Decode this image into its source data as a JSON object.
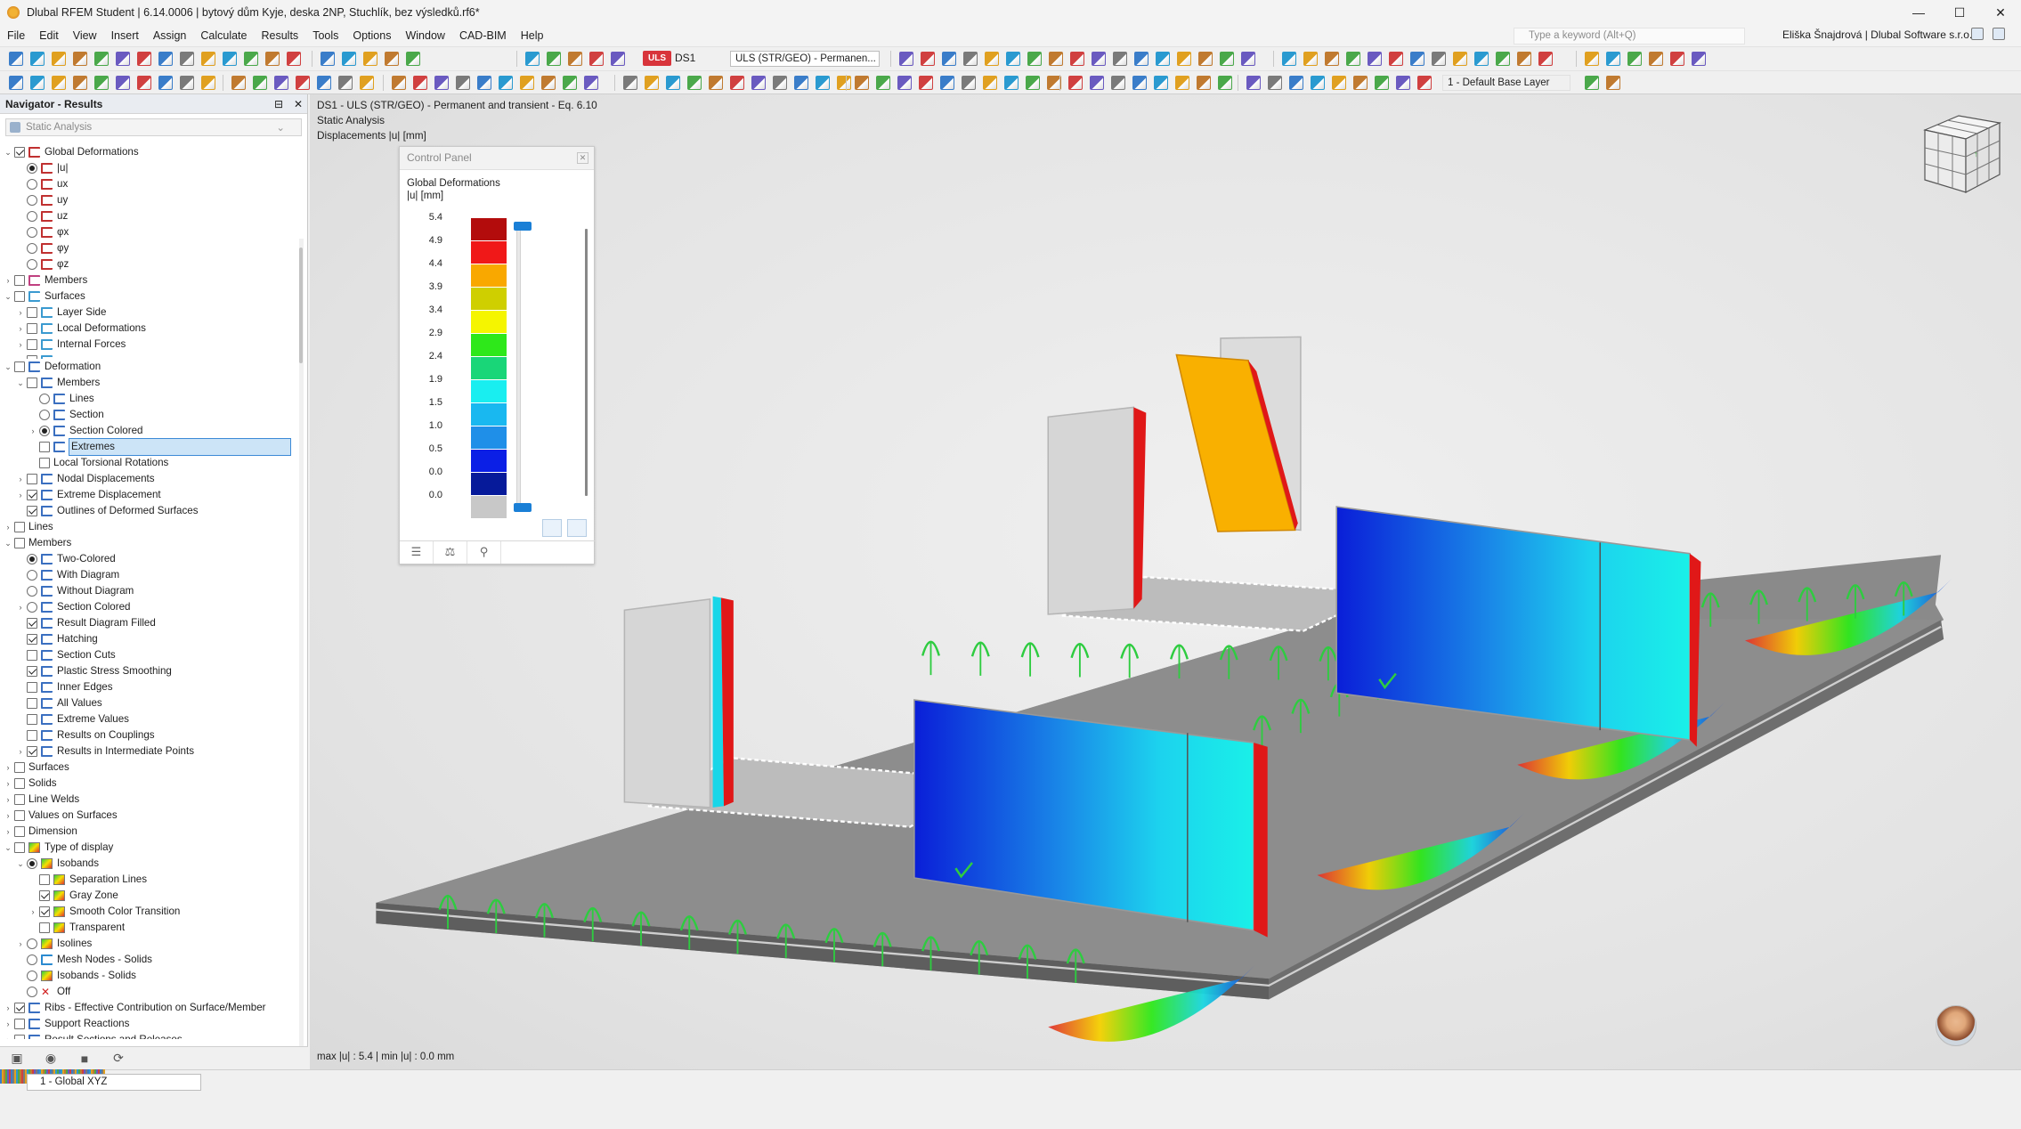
{
  "window": {
    "title": "Dlubal RFEM Student | 6.14.0006 | bytový dům Kyje, deska 2NP, Stuchlík, bez výsledků.rf6*",
    "minimize": "—",
    "maximize": "☐",
    "close": "✕"
  },
  "menu": {
    "items": [
      "File",
      "Edit",
      "View",
      "Insert",
      "Assign",
      "Calculate",
      "Results",
      "Tools",
      "Options",
      "Window",
      "CAD-BIM",
      "Help"
    ],
    "search_placeholder": "Type a keyword (Alt+Q)",
    "user": "Eliška Šnajdrová | Dlubal Software s.r.o."
  },
  "toolbar": {
    "uls_badge": "ULS",
    "design_situation": "DS1",
    "combination": "ULS (STR/GEO) - Permanen...",
    "layer": "1 - Default Base Layer"
  },
  "navigator": {
    "title": "Navigator - Results",
    "analysis_type": "Static Analysis",
    "tree": [
      {
        "label": "Global Deformations",
        "depth": 0,
        "expander": "open",
        "check": "on",
        "icon": "deform"
      },
      {
        "label": "|u|",
        "depth": 1,
        "radio": "on",
        "icon": "deform"
      },
      {
        "label": "ux",
        "depth": 1,
        "radio": "off",
        "icon": "deform"
      },
      {
        "label": "uy",
        "depth": 1,
        "radio": "off",
        "icon": "deform"
      },
      {
        "label": "uz",
        "depth": 1,
        "radio": "off",
        "icon": "deform"
      },
      {
        "label": "φx",
        "depth": 1,
        "radio": "off",
        "icon": "deform"
      },
      {
        "label": "φy",
        "depth": 1,
        "radio": "off",
        "icon": "deform"
      },
      {
        "label": "φz",
        "depth": 1,
        "radio": "off",
        "icon": "deform"
      },
      {
        "label": "Members",
        "depth": 0,
        "expander": "closed",
        "check": "off",
        "icon": "member"
      },
      {
        "label": "Surfaces",
        "depth": 0,
        "expander": "open",
        "check": "off",
        "icon": "surface"
      },
      {
        "label": "Layer Side",
        "depth": 1,
        "expander": "closed",
        "check": "off",
        "icon": "surface"
      },
      {
        "label": "Local Deformations",
        "depth": 1,
        "expander": "closed",
        "check": "off",
        "icon": "surface"
      },
      {
        "label": "Internal Forces",
        "depth": 1,
        "expander": "closed",
        "check": "off",
        "icon": "surface"
      },
      {
        "label": "",
        "depth": 1,
        "expander": "closed",
        "check": "off",
        "icon": "surface",
        "clipped": true
      },
      {
        "label": "Deformation",
        "depth": 0,
        "expander": "open",
        "check": "off",
        "icon": "deform2"
      },
      {
        "label": "Members",
        "depth": 1,
        "expander": "open",
        "check": "off",
        "icon": "deform2"
      },
      {
        "label": "Lines",
        "depth": 2,
        "radio": "off",
        "icon": "deform2"
      },
      {
        "label": "Section",
        "depth": 2,
        "radio": "off",
        "icon": "deform2"
      },
      {
        "label": "Section Colored",
        "depth": 2,
        "expander": "closed",
        "radio": "on",
        "icon": "deform2"
      },
      {
        "label": "Extremes",
        "depth": 2,
        "check": "off",
        "icon": "deform2",
        "selected": true
      },
      {
        "label": "Local Torsional Rotations",
        "depth": 2,
        "check": "off",
        "icon": "none"
      },
      {
        "label": "Nodal Displacements",
        "depth": 1,
        "expander": "closed",
        "check": "off",
        "icon": "deform2"
      },
      {
        "label": "Extreme Displacement",
        "depth": 1,
        "expander": "closed",
        "check": "on",
        "icon": "deform2"
      },
      {
        "label": "Outlines of Deformed Surfaces",
        "depth": 1,
        "check": "on",
        "icon": "deform2"
      },
      {
        "label": "Lines",
        "depth": 0,
        "expander": "closed",
        "check": "off",
        "icon": "none"
      },
      {
        "label": "Members",
        "depth": 0,
        "expander": "open",
        "check": "off",
        "icon": "none"
      },
      {
        "label": "Two-Colored",
        "depth": 1,
        "radio": "on",
        "icon": "deform2"
      },
      {
        "label": "With Diagram",
        "depth": 1,
        "radio": "off",
        "icon": "deform2"
      },
      {
        "label": "Without Diagram",
        "depth": 1,
        "radio": "off",
        "icon": "deform2"
      },
      {
        "label": "Section Colored",
        "depth": 1,
        "expander": "closed",
        "radio": "off",
        "icon": "deform2"
      },
      {
        "label": "Result Diagram Filled",
        "depth": 1,
        "check": "on",
        "icon": "deform2"
      },
      {
        "label": "Hatching",
        "depth": 1,
        "check": "on",
        "icon": "deform2"
      },
      {
        "label": "Section Cuts",
        "depth": 1,
        "check": "off",
        "icon": "deform2"
      },
      {
        "label": "Plastic Stress Smoothing",
        "depth": 1,
        "check": "on",
        "icon": "deform2"
      },
      {
        "label": "Inner Edges",
        "depth": 1,
        "check": "off",
        "icon": "deform2"
      },
      {
        "label": "All Values",
        "depth": 1,
        "check": "off",
        "icon": "deform2"
      },
      {
        "label": "Extreme Values",
        "depth": 1,
        "check": "off",
        "icon": "deform2"
      },
      {
        "label": "Results on Couplings",
        "depth": 1,
        "check": "off",
        "icon": "deform2"
      },
      {
        "label": "Results in Intermediate Points",
        "depth": 1,
        "expander": "closed",
        "check": "on",
        "icon": "deform2"
      },
      {
        "label": "Surfaces",
        "depth": 0,
        "expander": "closed",
        "check": "off",
        "icon": "none"
      },
      {
        "label": "Solids",
        "depth": 0,
        "expander": "closed",
        "check": "off",
        "icon": "none"
      },
      {
        "label": "Line Welds",
        "depth": 0,
        "expander": "closed",
        "check": "off",
        "icon": "none"
      },
      {
        "label": "Values on Surfaces",
        "depth": 0,
        "expander": "closed",
        "check": "off",
        "icon": "none"
      },
      {
        "label": "Dimension",
        "depth": 0,
        "expander": "closed",
        "check": "off",
        "icon": "none"
      },
      {
        "label": "Type of display",
        "depth": 0,
        "expander": "open",
        "check": "off",
        "icon": "display"
      },
      {
        "label": "Isobands",
        "depth": 1,
        "expander": "open",
        "radio": "on",
        "icon": "iso"
      },
      {
        "label": "Separation Lines",
        "depth": 2,
        "check": "off",
        "icon": "iso"
      },
      {
        "label": "Gray Zone",
        "depth": 2,
        "check": "on",
        "icon": "iso"
      },
      {
        "label": "Smooth Color Transition",
        "depth": 2,
        "expander": "closed",
        "check": "on",
        "icon": "iso"
      },
      {
        "label": "Transparent",
        "depth": 2,
        "check": "off",
        "icon": "iso"
      },
      {
        "label": "Isolines",
        "depth": 1,
        "expander": "closed",
        "radio": "off",
        "icon": "iso"
      },
      {
        "label": "Mesh Nodes - Solids",
        "depth": 1,
        "radio": "off",
        "icon": "mesh"
      },
      {
        "label": "Isobands - Solids",
        "depth": 1,
        "radio": "off",
        "icon": "iso"
      },
      {
        "label": "Off",
        "depth": 1,
        "radio": "off",
        "icon": "off"
      },
      {
        "label": "Ribs - Effective Contribution on Surface/Member",
        "depth": 0,
        "expander": "closed",
        "check": "on",
        "icon": "deform2"
      },
      {
        "label": "Support Reactions",
        "depth": 0,
        "expander": "closed",
        "check": "off",
        "icon": "deform2"
      },
      {
        "label": "Result Sections and Releases",
        "depth": 0,
        "expander": "closed",
        "check": "off",
        "icon": "deform2"
      }
    ]
  },
  "view": {
    "info_lines": [
      "DS1 - ULS (STR/GEO) - Permanent and transient - Eq. 6.10",
      "Static Analysis",
      "Displacements |u| [mm]"
    ],
    "status": "max |u| : 5.4 | min |u| : 0.0 mm"
  },
  "control_panel": {
    "title": "Control Panel",
    "heading": "Global Deformations",
    "unit": "|u| [mm]",
    "legend": [
      {
        "value": "5.4",
        "color": "#b30c0c"
      },
      {
        "value": "4.9",
        "color": "#f01818"
      },
      {
        "value": "4.4",
        "color": "#f9a800"
      },
      {
        "value": "3.9",
        "color": "#cfcf00"
      },
      {
        "value": "3.4",
        "color": "#f5f500"
      },
      {
        "value": "2.9",
        "color": "#2ee81a"
      },
      {
        "value": "2.4",
        "color": "#19d678"
      },
      {
        "value": "1.9",
        "color": "#19eef0"
      },
      {
        "value": "1.5",
        "color": "#19b8f0"
      },
      {
        "value": "1.0",
        "color": "#1f8fe8"
      },
      {
        "value": "0.5",
        "color": "#0b1fe6"
      },
      {
        "value": "0.0",
        "color": "#061a9a"
      },
      {
        "value": "0.0",
        "color": "#c8c8c8"
      }
    ]
  },
  "statusbar": {
    "coordinate_system": "1 - Global XYZ"
  }
}
